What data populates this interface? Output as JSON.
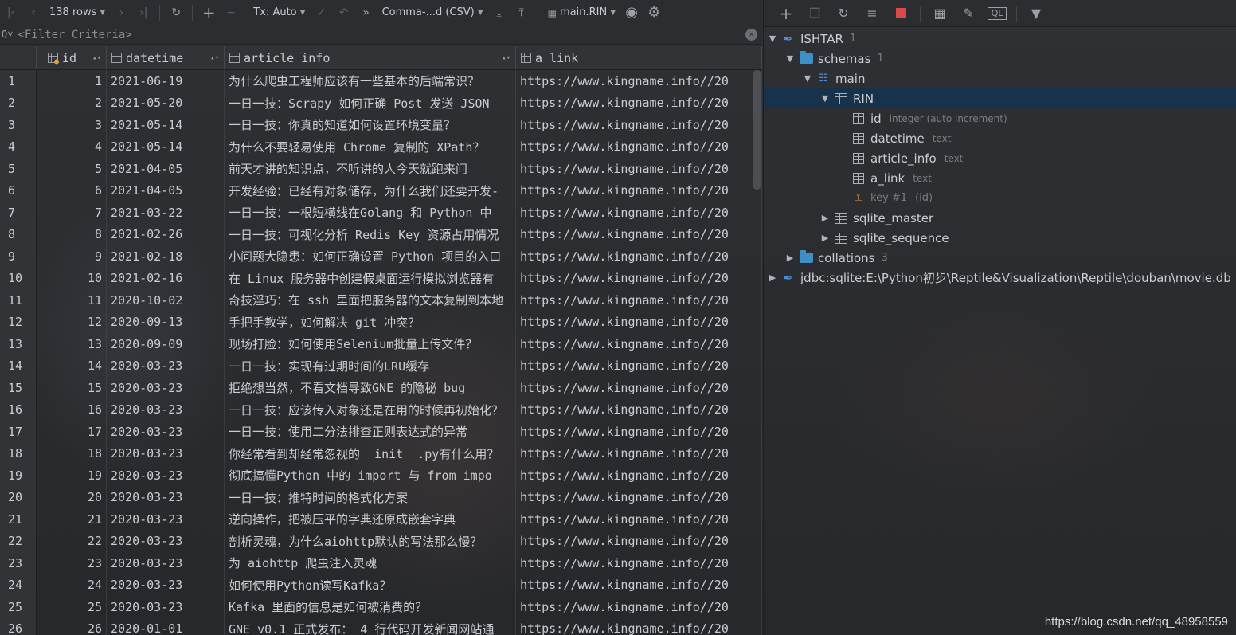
{
  "toolbar": {
    "rows_label": "138 rows",
    "tx_label": "Tx: Auto",
    "export_format": "Comma-...d (CSV)",
    "target": "main.RIN"
  },
  "filter": {
    "placeholder": "<Filter Criteria>"
  },
  "grid": {
    "columns": [
      "id",
      "datetime",
      "article_info",
      "a_link"
    ],
    "rows": [
      {
        "n": "1",
        "id": "1",
        "dt": "2021-06-19",
        "ai": "为什么爬虫工程师应该有一些基本的后端常识？",
        "al": "https://www.kingname.info//20"
      },
      {
        "n": "2",
        "id": "2",
        "dt": "2021-05-20",
        "ai": "一日一技：Scrapy 如何正确 Post 发送 JSON",
        "al": "https://www.kingname.info//20"
      },
      {
        "n": "3",
        "id": "3",
        "dt": "2021-05-14",
        "ai": "一日一技：你真的知道如何设置环境变量？",
        "al": "https://www.kingname.info//20"
      },
      {
        "n": "4",
        "id": "4",
        "dt": "2021-05-14",
        "ai": "为什么不要轻易使用 Chrome 复制的 XPath？",
        "al": "https://www.kingname.info//20"
      },
      {
        "n": "5",
        "id": "5",
        "dt": "2021-04-05",
        "ai": "前天才讲的知识点，不听讲的人今天就跑来问",
        "al": "https://www.kingname.info//20"
      },
      {
        "n": "6",
        "id": "6",
        "dt": "2021-04-05",
        "ai": "开发经验：已经有对象储存，为什么我们还要开发-",
        "al": "https://www.kingname.info//20"
      },
      {
        "n": "7",
        "id": "7",
        "dt": "2021-03-22",
        "ai": "一日一技：一根短横线在Golang 和 Python 中",
        "al": "https://www.kingname.info//20"
      },
      {
        "n": "8",
        "id": "8",
        "dt": "2021-02-26",
        "ai": "一日一技：可视化分析 Redis Key 资源占用情况",
        "al": "https://www.kingname.info//20"
      },
      {
        "n": "9",
        "id": "9",
        "dt": "2021-02-18",
        "ai": "小问题大隐患：如何正确设置 Python 项目的入口",
        "al": "https://www.kingname.info//20"
      },
      {
        "n": "10",
        "id": "10",
        "dt": "2021-02-16",
        "ai": "在 Linux 服务器中创建假桌面运行模拟浏览器有",
        "al": "https://www.kingname.info//20"
      },
      {
        "n": "11",
        "id": "11",
        "dt": "2020-10-02",
        "ai": "奇技淫巧：在 ssh 里面把服务器的文本复制到本地",
        "al": "https://www.kingname.info//20"
      },
      {
        "n": "12",
        "id": "12",
        "dt": "2020-09-13",
        "ai": "手把手教学，如何解决 git 冲突？",
        "al": "https://www.kingname.info//20"
      },
      {
        "n": "13",
        "id": "13",
        "dt": "2020-09-09",
        "ai": "现场打脸：如何使用Selenium批量上传文件？",
        "al": "https://www.kingname.info//20"
      },
      {
        "n": "14",
        "id": "14",
        "dt": "2020-03-23",
        "ai": "一日一技：实现有过期时间的LRU缓存",
        "al": "https://www.kingname.info//20"
      },
      {
        "n": "15",
        "id": "15",
        "dt": "2020-03-23",
        "ai": "拒绝想当然，不看文档导致GNE 的隐秘 bug",
        "al": "https://www.kingname.info//20"
      },
      {
        "n": "16",
        "id": "16",
        "dt": "2020-03-23",
        "ai": "一日一技：应该传入对象还是在用的时候再初始化？",
        "al": "https://www.kingname.info//20"
      },
      {
        "n": "17",
        "id": "17",
        "dt": "2020-03-23",
        "ai": "一日一技：使用二分法排查正则表达式的异常",
        "al": "https://www.kingname.info//20"
      },
      {
        "n": "18",
        "id": "18",
        "dt": "2020-03-23",
        "ai": "你经常看到却经常忽视的__init__.py有什么用？",
        "al": "https://www.kingname.info//20"
      },
      {
        "n": "19",
        "id": "19",
        "dt": "2020-03-23",
        "ai": "彻底搞懂Python 中的 import 与 from impo",
        "al": "https://www.kingname.info//20"
      },
      {
        "n": "20",
        "id": "20",
        "dt": "2020-03-23",
        "ai": "一日一技：推特时间的格式化方案",
        "al": "https://www.kingname.info//20"
      },
      {
        "n": "21",
        "id": "21",
        "dt": "2020-03-23",
        "ai": "逆向操作，把被压平的字典还原成嵌套字典",
        "al": "https://www.kingname.info//20"
      },
      {
        "n": "22",
        "id": "22",
        "dt": "2020-03-23",
        "ai": "剖析灵魂，为什么aiohttp默认的写法那么慢？",
        "al": "https://www.kingname.info//20"
      },
      {
        "n": "23",
        "id": "23",
        "dt": "2020-03-23",
        "ai": "为 aiohttp 爬虫注入灵魂",
        "al": "https://www.kingname.info//20"
      },
      {
        "n": "24",
        "id": "24",
        "dt": "2020-03-23",
        "ai": "如何使用Python读写Kafka？",
        "al": "https://www.kingname.info//20"
      },
      {
        "n": "25",
        "id": "25",
        "dt": "2020-03-23",
        "ai": "Kafka 里面的信息是如何被消费的？",
        "al": "https://www.kingname.info//20"
      },
      {
        "n": "26",
        "id": "26",
        "dt": "2020-01-01",
        "ai": "GNE v0.1 正式发布： 4 行代码开发新闻网站通",
        "al": "https://www.kingname.info//20"
      }
    ]
  },
  "tree": {
    "root": {
      "label": "ISHTAR",
      "count": "1"
    },
    "schemas": {
      "label": "schemas",
      "count": "1"
    },
    "main": {
      "label": "main"
    },
    "table": {
      "label": "RIN"
    },
    "columns": [
      {
        "name": "id",
        "type": "integer (auto increment)"
      },
      {
        "name": "datetime",
        "type": "text"
      },
      {
        "name": "article_info",
        "type": "text"
      },
      {
        "name": "a_link",
        "type": "text"
      }
    ],
    "key": {
      "name": "key #1",
      "detail": "(id)"
    },
    "other_tables": [
      "sqlite_master",
      "sqlite_sequence"
    ],
    "collations": {
      "label": "collations",
      "count": "3"
    },
    "connection": "jdbc:sqlite:E:\\Python初步\\Reptile&Visualization\\Reptile\\douban\\movie.db"
  },
  "watermark": "https://blog.csdn.net/qq_48958559",
  "colors": {
    "accent": "#3d8fc6",
    "selection": "#143250",
    "stop": "#d94b4b",
    "key": "#d9a343"
  }
}
